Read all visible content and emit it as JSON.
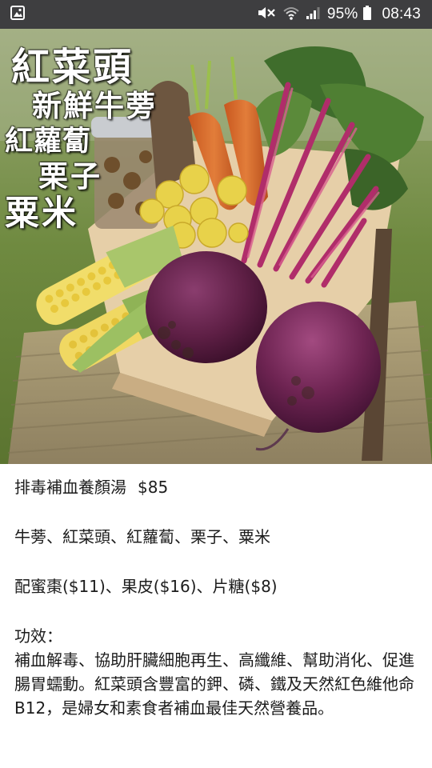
{
  "status_bar": {
    "battery": "95%",
    "time": "08:43",
    "icons": [
      "image-notification-icon",
      "mute-icon",
      "wifi-icon",
      "signal-icon",
      "battery-icon"
    ]
  },
  "photo": {
    "caption_lines": [
      "紅菜頭",
      "新鮮牛蒡",
      "紅蘿蔔",
      "栗子",
      "粟米"
    ]
  },
  "post": {
    "product_name": "排毒補血養顏湯",
    "price": "$85",
    "ingredients": "牛蒡、紅菜頭、紅蘿蔔、栗子、粟米",
    "addons": "配蜜棗($11)、果皮($16)、片糖($8)",
    "benefits_heading": "功效：",
    "benefits_text": "補血解毒、協助肝臟細胞再生、高纖維、幫助消化、促進腸胃蠕動。紅菜頭含豐富的鉀、磷、鐵及天然紅色維他命B12，是婦女和素食者補血最佳天然營養品。"
  },
  "colors": {
    "status_bar_bg": "#3e3e40",
    "text": "#1c1c1c",
    "background": "#ffffff"
  }
}
